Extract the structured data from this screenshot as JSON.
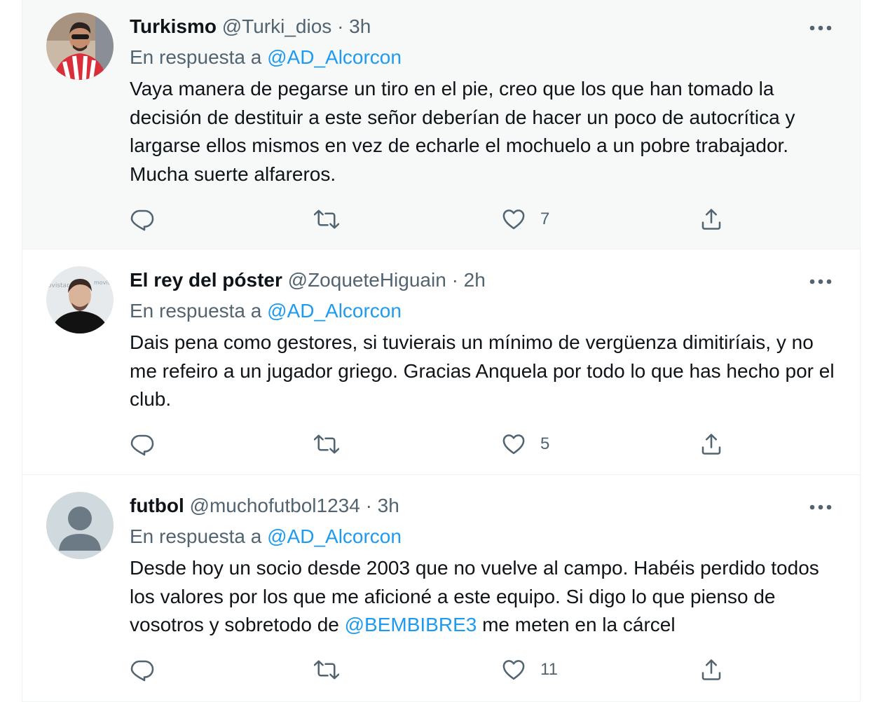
{
  "tweets": [
    {
      "name": "Turkismo",
      "handle": "@Turki_dios",
      "separator": "·",
      "time": "3h",
      "reply_prefix": "En respuesta a",
      "reply_handle": "@AD_Alcorcon",
      "text": "Vaya manera de pegarse un tiro en el pie, creo que los que han tomado la decisión de destituir a este señor deberían de hacer un poco de autocrítica y largarse ellos mismos en vez de echarle el mochuelo a un pobre trabajador. Mucha suerte alfareros.",
      "likes": "7",
      "highlighted": true
    },
    {
      "name": "El rey del póster",
      "handle": "@ZoqueteHiguain",
      "separator": "·",
      "time": "2h",
      "reply_prefix": "En respuesta a",
      "reply_handle": "@AD_Alcorcon",
      "text": "Dais pena como gestores, si tuvierais un mínimo de vergüenza dimitiríais, y no me refeiro a un jugador griego. Gracias Anquela por todo lo que has hecho por el club.",
      "likes": "5"
    },
    {
      "name": "futbol",
      "handle": "@muchofutbol1234",
      "separator": "·",
      "time": "3h",
      "reply_prefix": "En respuesta a",
      "reply_handle": "@AD_Alcorcon",
      "text_before_mention": "Desde hoy un socio desde 2003 que no vuelve al campo. Habéis perdido todos los valores por los que me aficioné a este equipo. Si digo lo que pienso de vosotros y sobretodo de ",
      "mention": "@BEMBIBRE3",
      "text_after_mention": " me meten en la cárcel",
      "likes": "11"
    }
  ],
  "icons": {
    "reply": "reply-icon",
    "retweet": "retweet-icon",
    "like": "heart-icon",
    "share": "share-icon",
    "more": "more-icon"
  },
  "colors": {
    "link": "#1d9bf0",
    "secondary_text": "#536471",
    "primary_text": "#0f1419",
    "highlight_bg": "#f7f9f9"
  }
}
